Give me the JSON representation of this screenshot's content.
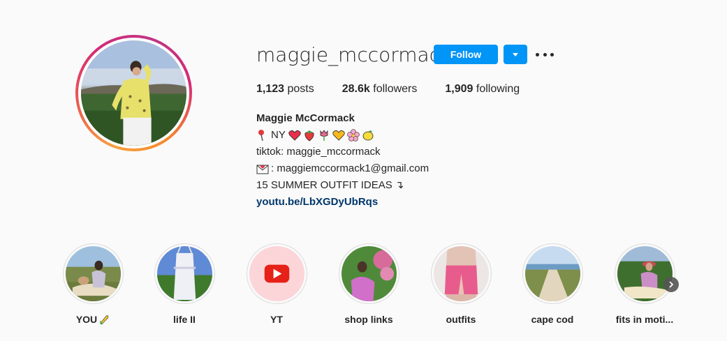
{
  "profile": {
    "username": "maggie_mccormack",
    "follow_label": "Follow",
    "dropdown_icon": "chevron-down-icon",
    "more_icon": "more-options-icon",
    "stats": {
      "posts_count": "1,123",
      "posts_label": "posts",
      "followers_count": "28.6k",
      "followers_label": "followers",
      "following_count": "1,909",
      "following_label": "following"
    },
    "bio": {
      "name": "Maggie McCormack",
      "location_text": "NY",
      "location_emojis": [
        "round-pushpin",
        "red-heart",
        "strawberry",
        "tulip",
        "yellow-heart",
        "cherry-blossom",
        "lemon"
      ],
      "tiktok": "tiktok: maggie_mccormack",
      "email": ": maggiemccormack1@gmail.com",
      "email_emoji": "envelope-with-heart",
      "headline": "15 SUMMER OUTFIT IDEAS ↴",
      "link": "youtu.be/LbXGDyUbRqs"
    }
  },
  "highlights": [
    {
      "label": "YOU",
      "emoji": "corn"
    },
    {
      "label": "life II"
    },
    {
      "label": "YT",
      "icon": "youtube-icon"
    },
    {
      "label": "shop links"
    },
    {
      "label": "outfits"
    },
    {
      "label": "cape cod"
    },
    {
      "label": "fits in moti..."
    }
  ],
  "colors": {
    "accent": "#0095f6",
    "link": "#00376b",
    "background": "#fafafa",
    "text": "#262626"
  }
}
